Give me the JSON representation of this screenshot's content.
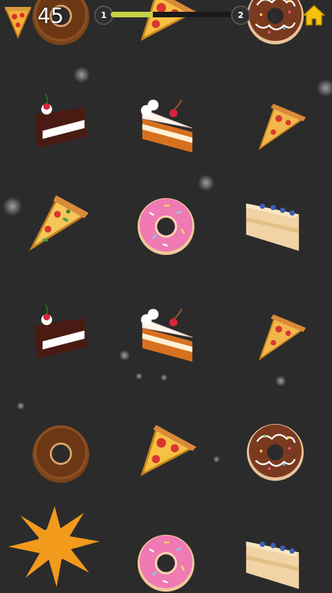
{
  "hud": {
    "score": "45",
    "level_current": "1",
    "level_next": "2",
    "level_progress": 0.33,
    "home_icon": "home-icon",
    "accent": "#f4c20d"
  },
  "grid": {
    "columns": 3,
    "rows": [
      [
        "donut-chocolate",
        "pizza-slice",
        "donut-sprinkle-dark"
      ],
      [
        "cake-chocolate",
        "cake-cream",
        "pizza-slice-small"
      ],
      [
        "pizza-veggie",
        "donut-pink",
        "cake-blueberry"
      ],
      [
        "cake-chocolate",
        "cake-cream",
        "pizza-slice-small"
      ],
      [
        "donut-chocolate",
        "pizza-slice",
        "donut-sprinkle-dark"
      ],
      [
        "splat-orange",
        "donut-pink",
        "cake-blueberry"
      ]
    ]
  }
}
